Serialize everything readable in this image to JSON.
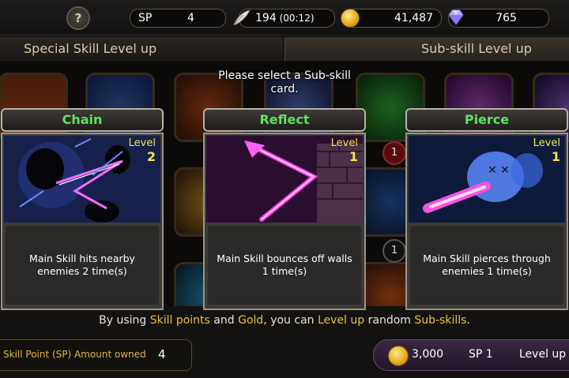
{
  "top_bar": {
    "help_label": "?",
    "sp_label": "SP",
    "sp_value": "4",
    "energy_value": "194",
    "energy_timer": "(00:12)",
    "gold_value": "41,487",
    "gem_value": "765"
  },
  "tabs": [
    {
      "label": "Special Skill Level up",
      "active": false
    },
    {
      "label": "Sub-skill Level up",
      "active": true
    }
  ],
  "background_badges": [
    "1",
    "1"
  ],
  "prompt": "Please select a Sub-skill card.",
  "cards": [
    {
      "title": "Chain",
      "level_label": "Level",
      "level": "2",
      "description": "Main Skill hits nearby enemies 2 time(s)",
      "icon": "chain-art-icon"
    },
    {
      "title": "Reflect",
      "level_label": "Level",
      "level": "1",
      "description": "Main Skill bounces off walls 1 time(s)",
      "icon": "reflect-art-icon"
    },
    {
      "title": "Pierce",
      "level_label": "Level",
      "level": "1",
      "description": "Main Skill pierces through enemies 1 time(s)",
      "icon": "pierce-art-icon"
    }
  ],
  "hint": {
    "p1": "By using ",
    "hl1": "Skill points",
    "p2": " and ",
    "hl2": "Gold",
    "p3": ", you can ",
    "hl3": "Level up",
    "p4": " random ",
    "hl4": "Sub-skills",
    "p5": "."
  },
  "footer": {
    "sp_owned_label": "Skill Point (SP) Amount owned",
    "sp_owned_value": "4",
    "levelup_cost": "3,000",
    "levelup_sp": "SP 1",
    "levelup_label": "Level up"
  },
  "colors": {
    "accent_gold": "#e8c13a",
    "card_title_green": "#5ee35e",
    "level_yellow": "#f2e44a"
  }
}
